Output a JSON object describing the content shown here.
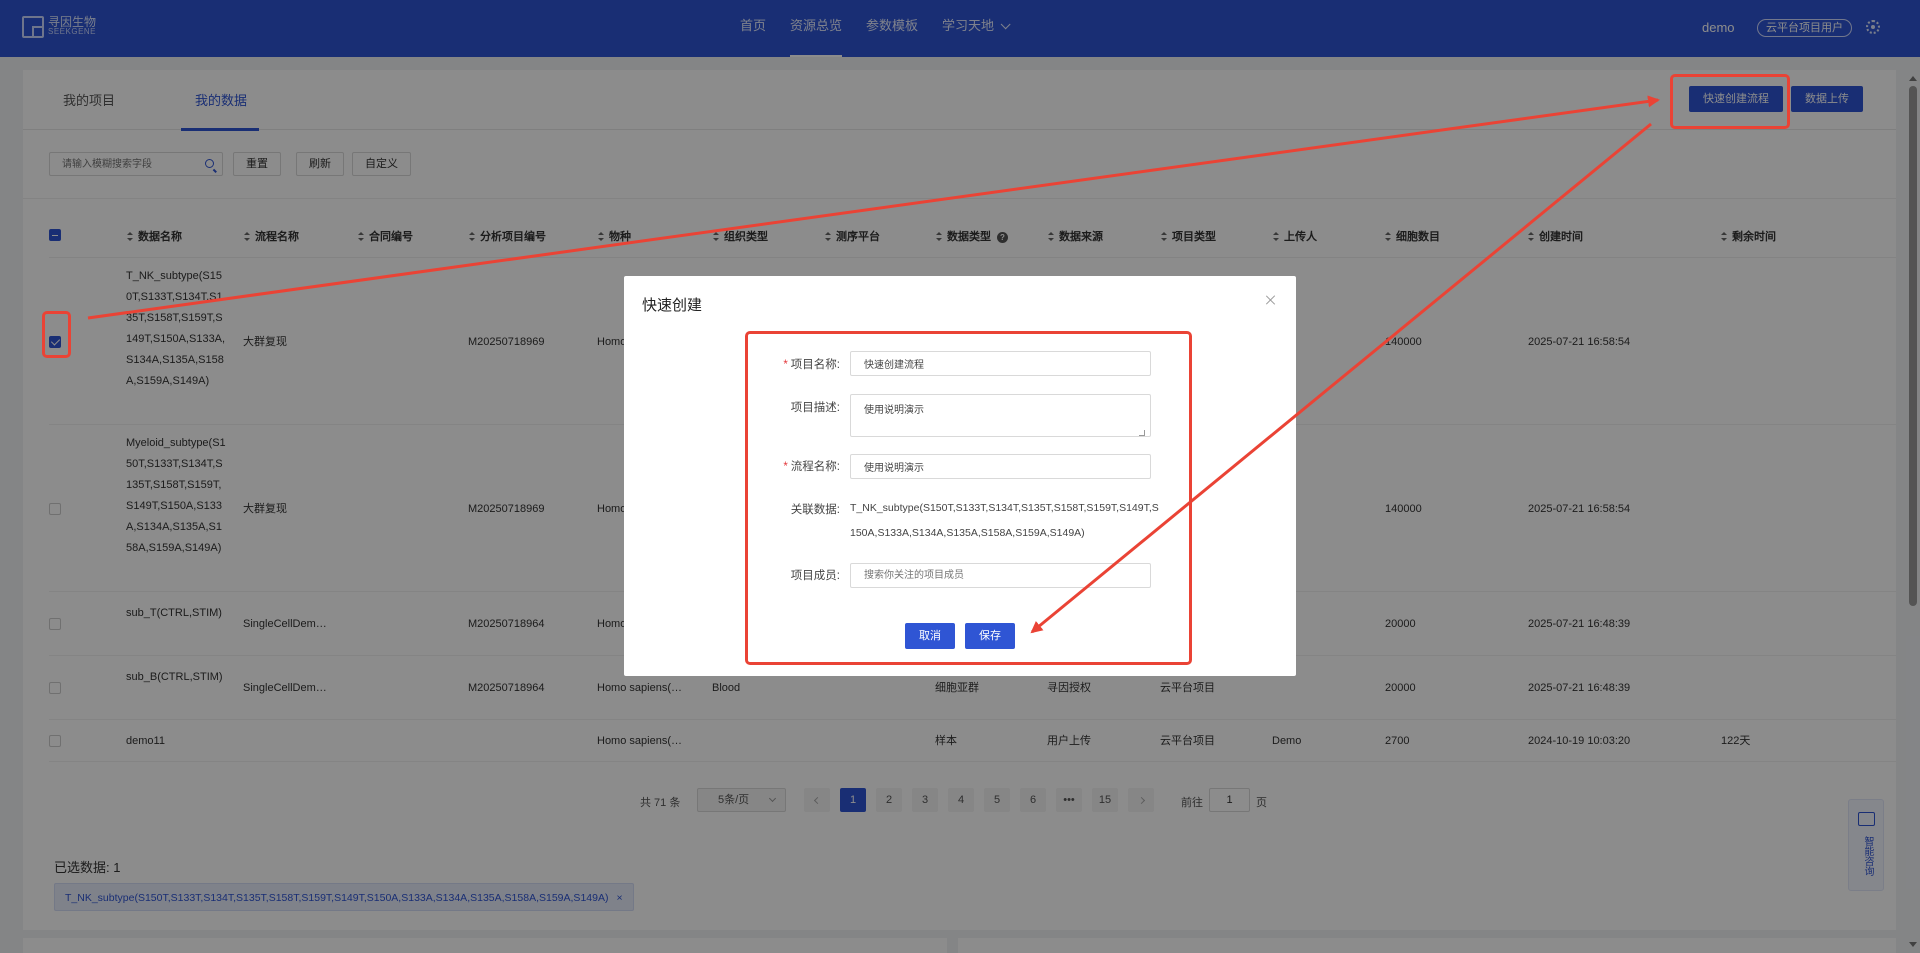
{
  "logo": {
    "cn": "寻因生物",
    "en": "SEEKGENE"
  },
  "nav": {
    "items": [
      "首页",
      "资源总览",
      "参数模板",
      "学习天地"
    ],
    "active_index": 1
  },
  "user": {
    "name": "demo",
    "role": "云平台项目用户"
  },
  "tabs": {
    "items": [
      "我的项目",
      "我的数据"
    ],
    "active_index": 1
  },
  "actions": {
    "quick_create": "快速创建流程",
    "upload": "数据上传"
  },
  "toolbar": {
    "search_placeholder": "请输入模糊搜索字段",
    "reset": "重置",
    "refresh": "刷新",
    "custom": "自定义"
  },
  "table": {
    "columns": [
      "数据名称",
      "流程名称",
      "合同编号",
      "分析项目编号",
      "物种",
      "组织类型",
      "测序平台",
      "数据类型",
      "数据来源",
      "项目类型",
      "上传人",
      "细胞数目",
      "创建时间",
      "剩余时间"
    ],
    "rows": [
      {
        "name": "T_NK_subtype(S150T,S133T,S134T,S135T,S158T,S159T,S149T,S150A,S133A,S134A,S135A,S158A,S159A,S149A)",
        "flow": "大群复现",
        "contract": "",
        "project_no": "M20250718969",
        "species": "Homo sapiens(Human)",
        "tissue": "",
        "platform": "",
        "data_type": "",
        "source": "",
        "proj_type": "",
        "uploader": "",
        "cells": "140000",
        "created": "2025-07-21 16:58:54",
        "remain": "",
        "checked": true
      },
      {
        "name": "Myeloid_subtype(S150T,S133T,S134T,S135T,S158T,S159T,S149T,S150A,S133A,S134A,S135A,S158A,S159A,S149A)",
        "flow": "大群复现",
        "contract": "",
        "project_no": "M20250718969",
        "species": "Homo sapiens(Human)",
        "tissue": "",
        "platform": "",
        "data_type": "",
        "source": "",
        "proj_type": "",
        "uploader": "",
        "cells": "140000",
        "created": "2025-07-21 16:58:54",
        "remain": "",
        "checked": false
      },
      {
        "name": "sub_T(CTRL,STIM)",
        "flow": "SingleCellDem…",
        "contract": "",
        "project_no": "M20250718964",
        "species": "Homo sapiens(Human)",
        "tissue": "",
        "platform": "",
        "data_type": "",
        "source": "",
        "proj_type": "",
        "uploader": "",
        "cells": "20000",
        "created": "2025-07-21 16:48:39",
        "remain": "",
        "checked": false
      },
      {
        "name": "sub_B(CTRL,STIM)",
        "flow": "SingleCellDem…",
        "contract": "",
        "project_no": "M20250718964",
        "species": "Homo sapiens(…",
        "tissue": "Blood",
        "platform": "",
        "data_type": "细胞亚群",
        "source": "寻因授权",
        "proj_type": "云平台项目",
        "uploader": "",
        "cells": "20000",
        "created": "2025-07-21 16:48:39",
        "remain": "",
        "checked": false
      },
      {
        "name": "demo11",
        "flow": "",
        "contract": "",
        "project_no": "",
        "species": "Homo sapiens(…",
        "tissue": "",
        "platform": "",
        "data_type": "样本",
        "source": "用户上传",
        "proj_type": "云平台项目",
        "uploader": "Demo",
        "cells": "2700",
        "created": "2024-10-19 10:03:20",
        "remain": "122天",
        "checked": false
      }
    ]
  },
  "pagination": {
    "total": "共 71 条",
    "page_size": "5条/页",
    "pages": [
      "1",
      "2",
      "3",
      "4",
      "5",
      "6",
      "•••",
      "15"
    ],
    "active": "1",
    "jump_prefix": "前往",
    "jump_value": "1",
    "jump_suffix": "页"
  },
  "selected": {
    "label": "已选数据: 1",
    "tag": "T_NK_subtype(S150T,S133T,S134T,S135T,S158T,S159T,S149T,S150A,S133A,S134A,S135A,S158A,S159A,S149A)",
    "tag_close": "×"
  },
  "help": {
    "label": "智能咨询"
  },
  "modal": {
    "title": "快速创建",
    "fields": {
      "project_name_label": "项目名称:",
      "project_name_value": "快速创建流程",
      "project_desc_label": "项目描述:",
      "project_desc_value": "使用说明演示",
      "flow_name_label": "流程名称:",
      "flow_name_value": "使用说明演示",
      "linked_data_label": "关联数据:",
      "linked_data_value": "T_NK_subtype(S150T,S133T,S134T,S135T,S158T,S159T,S149T,S150A,S133A,S134A,S135A,S158A,S159A,S149A)",
      "members_label": "项目成员:",
      "members_placeholder": "搜索你关注的项目成员"
    },
    "cancel": "取消",
    "save": "保存"
  },
  "colors": {
    "brand": "#2f55d4",
    "annotation": "#ea4335"
  }
}
